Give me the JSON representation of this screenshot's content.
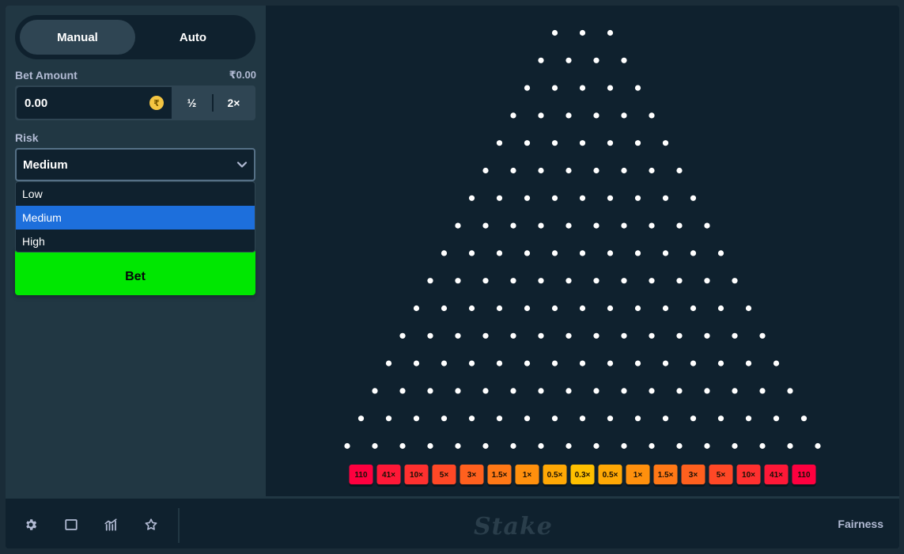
{
  "mode_toggle": {
    "manual": "Manual",
    "auto": "Auto",
    "active": "Manual"
  },
  "bet_amount": {
    "label": "Bet Amount",
    "balance": "₹0.00",
    "value": "0.00",
    "currency_symbol": "₹",
    "half": "½",
    "double": "2×"
  },
  "risk": {
    "label": "Risk",
    "selected": "Medium",
    "options": [
      "Low",
      "Medium",
      "High"
    ]
  },
  "bet_button": "Bet",
  "board": {
    "rows": 16,
    "first_row_pins": 3,
    "pin_color": "#ffffff",
    "multipliers": [
      {
        "label": "110",
        "color": "#ff003f"
      },
      {
        "label": "41×",
        "color": "#ff1837"
      },
      {
        "label": "10×",
        "color": "#ff302f"
      },
      {
        "label": "5×",
        "color": "#ff4826"
      },
      {
        "label": "3×",
        "color": "#ff601e"
      },
      {
        "label": "1.5×",
        "color": "#ff7816"
      },
      {
        "label": "1×",
        "color": "#ff900d"
      },
      {
        "label": "0.5×",
        "color": "#ffa805"
      },
      {
        "label": "0.3×",
        "color": "#ffc000"
      },
      {
        "label": "0.5×",
        "color": "#ffa805"
      },
      {
        "label": "1×",
        "color": "#ff900d"
      },
      {
        "label": "1.5×",
        "color": "#ff7816"
      },
      {
        "label": "3×",
        "color": "#ff601e"
      },
      {
        "label": "5×",
        "color": "#ff4826"
      },
      {
        "label": "10×",
        "color": "#ff302f"
      },
      {
        "label": "41×",
        "color": "#ff1837"
      },
      {
        "label": "110",
        "color": "#ff003f"
      }
    ]
  },
  "footer": {
    "icons": [
      "settings-icon",
      "theatre-mode-icon",
      "stats-icon",
      "favorite-star-icon"
    ],
    "logo": "Stake",
    "fairness": "Fairness"
  },
  "colors": {
    "accent_green": "#00e701",
    "selected_blue": "#1d6fdc",
    "panel": "#213743",
    "background": "#0f212e"
  }
}
